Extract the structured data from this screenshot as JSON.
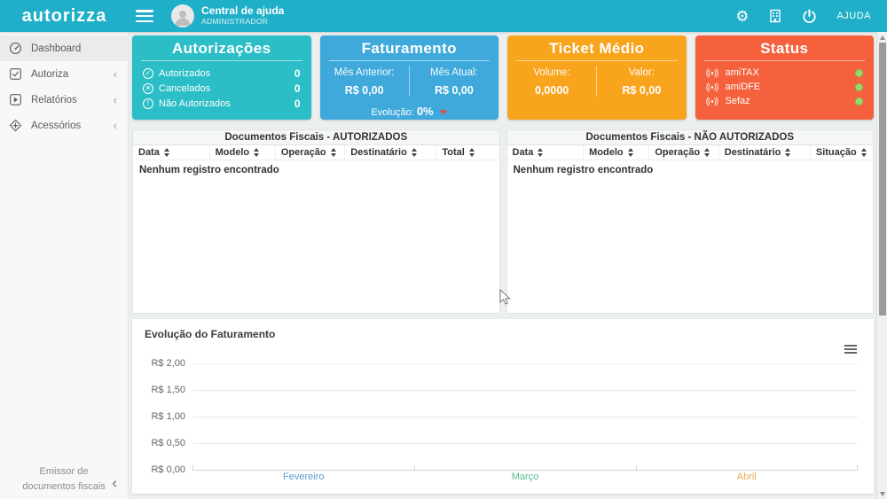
{
  "icons": {
    "check": "✓",
    "cross": "✕",
    "exclaim": "!",
    "heart": "❤",
    "gear": "⚙",
    "chevron": "‹"
  },
  "navbar": {
    "logo": "autorizza",
    "help_center": "Central de ajuda",
    "role": "ADMINISTRADOR",
    "help_label": "AJUDA"
  },
  "sidebar": {
    "items": [
      {
        "label": "Dashboard"
      },
      {
        "label": "Autoriza"
      },
      {
        "label": "Relatórios"
      },
      {
        "label": "Acessórios"
      }
    ],
    "footer_line1": "Emissor de",
    "footer_line2": "documentos fiscais"
  },
  "cards": {
    "autorizacoes": {
      "title": "Autorizações",
      "color": "#2CBEC6",
      "rows": [
        {
          "label": "Autorizados",
          "value": "0"
        },
        {
          "label": "Cancelados",
          "value": "0"
        },
        {
          "label": "Não Autorizados",
          "value": "0"
        }
      ]
    },
    "faturamento": {
      "title": "Faturamento",
      "color": "#3FA9DC",
      "prev_label": "Mês Anterior:",
      "prev_value": "R$ 0,00",
      "curr_label": "Mês Atual:",
      "curr_value": "R$ 0,00",
      "evolution_label": "Evolução:",
      "evolution_value": "0%"
    },
    "ticket_medio": {
      "title": "Ticket Médio",
      "color": "#F8A41D",
      "volume_label": "Volume:",
      "volume_value": "0,0000",
      "valor_label": "Valor:",
      "valor_value": "R$ 0,00"
    },
    "status": {
      "title": "Status",
      "color": "#F4613C",
      "online_color": "#97D96F",
      "services": [
        {
          "name": "amiTAX"
        },
        {
          "name": "amiDFE"
        },
        {
          "name": "Sefaz"
        }
      ]
    }
  },
  "tables": {
    "authorized": {
      "title": "Documentos Fiscais - AUTORIZADOS",
      "columns": [
        "Data",
        "Modelo",
        "Operação",
        "Destinatário",
        "Total"
      ],
      "empty_message": "Nenhum registro encontrado"
    },
    "not_authorized": {
      "title": "Documentos Fiscais - NÃO AUTORIZADOS",
      "columns": [
        "Data",
        "Modelo",
        "Operação",
        "Destinatário",
        "Situação"
      ],
      "empty_message": "Nenhum registro encontrado"
    }
  },
  "chart_data": {
    "type": "line",
    "title": "Evolução do Faturamento",
    "categories": [
      "Fevereiro",
      "Março",
      "Abril"
    ],
    "category_colors": [
      "#5B9BD5",
      "#57C08E",
      "#E3AD4F"
    ],
    "series": [],
    "values": [],
    "yticks": [
      "R$ 2,00",
      "R$ 1,50",
      "R$ 1,00",
      "R$ 0,50",
      "R$ 0,00"
    ],
    "ylim": [
      0,
      2
    ],
    "grid": true,
    "note": "empty chart - no data plotted"
  }
}
